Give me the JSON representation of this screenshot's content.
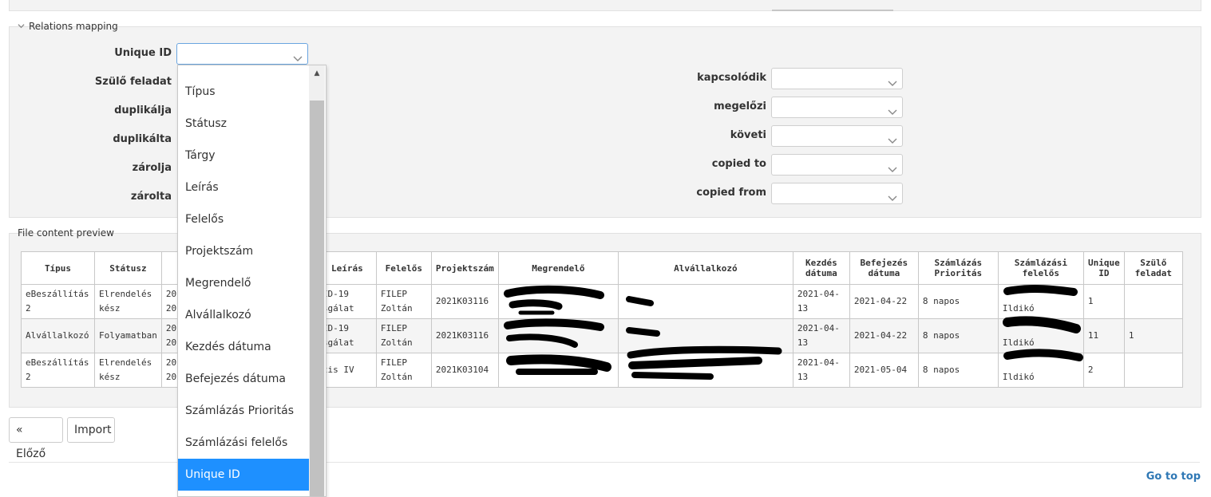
{
  "relations": {
    "legend": "Relations mapping",
    "left_labels": [
      "Unique ID",
      "Szülő feladat",
      "duplikálja",
      "duplikálta",
      "zárolja",
      "zárolta"
    ],
    "right_labels": [
      "kapcsolódik",
      "megelőzi",
      "követi",
      "copied to",
      "copied from"
    ]
  },
  "dropdown": {
    "options": [
      "Típus",
      "Státusz",
      "Tárgy",
      "Leírás",
      "Felelős",
      "Projektszám",
      "Megrendelő",
      "Alvállalkozó",
      "Kezdés dátuma",
      "Befejezés dátuma",
      "Számlázás Prioritás",
      "Számlázási felelős",
      "Unique ID"
    ],
    "selected": "Unique ID"
  },
  "preview": {
    "legend": "File content preview",
    "headers": [
      "Típus",
      "Státusz",
      "",
      "Leírás",
      "Felelős",
      "Projektszám",
      "Megrendelő",
      "Alvállalkozó",
      "Kezdés dátuma",
      "Befejezés dátuma",
      "Számlázás Prioritás",
      "Számlázási felelős",
      "Unique ID",
      "Szülő feladat"
    ],
    "rows": [
      [
        "eBeszállítás 2",
        "Elrendelés kész",
        "20\n20",
        "ID-19\nsgálat",
        "FILEP Zoltán",
        "2021K03116",
        "",
        "",
        "2021-04-13",
        "2021-04-22",
        "8 napos",
        "Ildikó",
        "1",
        ""
      ],
      [
        "Alvállalkozó",
        "Folyamatban",
        "20\n20",
        "ID-19\nsgálat",
        "FILEP Zoltán",
        "2021K03116",
        "",
        "",
        "2021-04-13",
        "2021-04-22",
        "8 napos",
        "Ildikó",
        "11",
        "1"
      ],
      [
        "eBeszállítás 2",
        "Elrendelés kész",
        "20\n20",
        "tis IV",
        "FILEP Zoltán",
        "2021K03104",
        "",
        "",
        "2021-04-13",
        "2021-05-04",
        "8 napos",
        "Ildikó",
        "2",
        ""
      ]
    ]
  },
  "buttons": {
    "prev": "« Előző",
    "import": "Import"
  },
  "footer": {
    "go_top": "Go to top"
  }
}
